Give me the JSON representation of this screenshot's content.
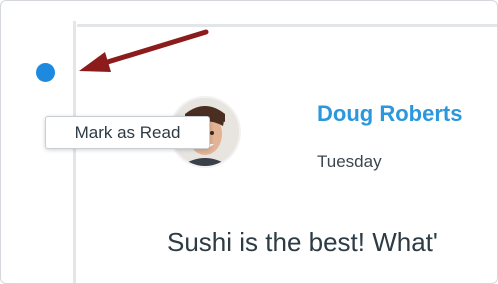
{
  "tooltip": {
    "text": "Mark as Read"
  },
  "post": {
    "author": "Doug Roberts",
    "date": "Tuesday",
    "message": "Sushi is the best! What'"
  },
  "icons": {
    "unread_indicator": "unread-dot-icon",
    "pointer": "red-arrow-icon",
    "avatar": "user-avatar"
  },
  "colors": {
    "unread_dot": "#1d8ae0",
    "author_link": "#2b97dd",
    "arrow": "#8c1b1b"
  }
}
